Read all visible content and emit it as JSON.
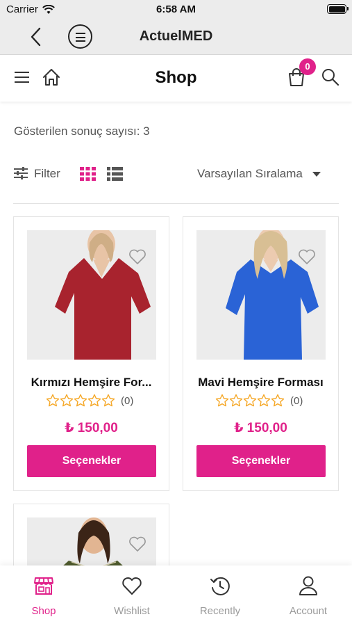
{
  "status_bar": {
    "carrier": "Carrier",
    "time": "6:58 AM"
  },
  "app_bar": {
    "title": "ActuelMED",
    "back_icon": "chevron-left-icon",
    "menu_icon": "circle-menu-icon"
  },
  "shop_header": {
    "title": "Shop",
    "cart_count": "0",
    "icons": [
      "hamburger-icon",
      "home-icon",
      "cart-icon",
      "search-icon"
    ]
  },
  "results": {
    "count_text": "Gösterilen sonuç sayısı: 3"
  },
  "toolbar": {
    "filter_label": "Filter",
    "sort_label": "Varsayılan Sıralama",
    "view_modes": [
      "grid",
      "list"
    ],
    "active_view": "grid"
  },
  "products": [
    {
      "name": "Kırmızı Hemşire For...",
      "reviews": "(0)",
      "price": "₺ 150,00",
      "button": "Seçenekler",
      "image_color": "#a8232e"
    },
    {
      "name": "Mavi Hemşire Forması",
      "reviews": "(0)",
      "price": "₺ 150,00",
      "button": "Seçenekler",
      "image_color": "#2a63d6"
    },
    {
      "name": "",
      "reviews": "",
      "price": "",
      "button": "",
      "image_color": "#4e5a2c"
    }
  ],
  "tabbar": {
    "items": [
      {
        "label": "Shop",
        "icon": "store-icon",
        "active": true
      },
      {
        "label": "Wishlist",
        "icon": "heart-icon",
        "active": false
      },
      {
        "label": "Recently",
        "icon": "history-icon",
        "active": false
      },
      {
        "label": "Account",
        "icon": "user-icon",
        "active": false
      }
    ]
  },
  "colors": {
    "accent": "#e0218a",
    "star": "#f5a623",
    "topbar": "#ececec"
  }
}
